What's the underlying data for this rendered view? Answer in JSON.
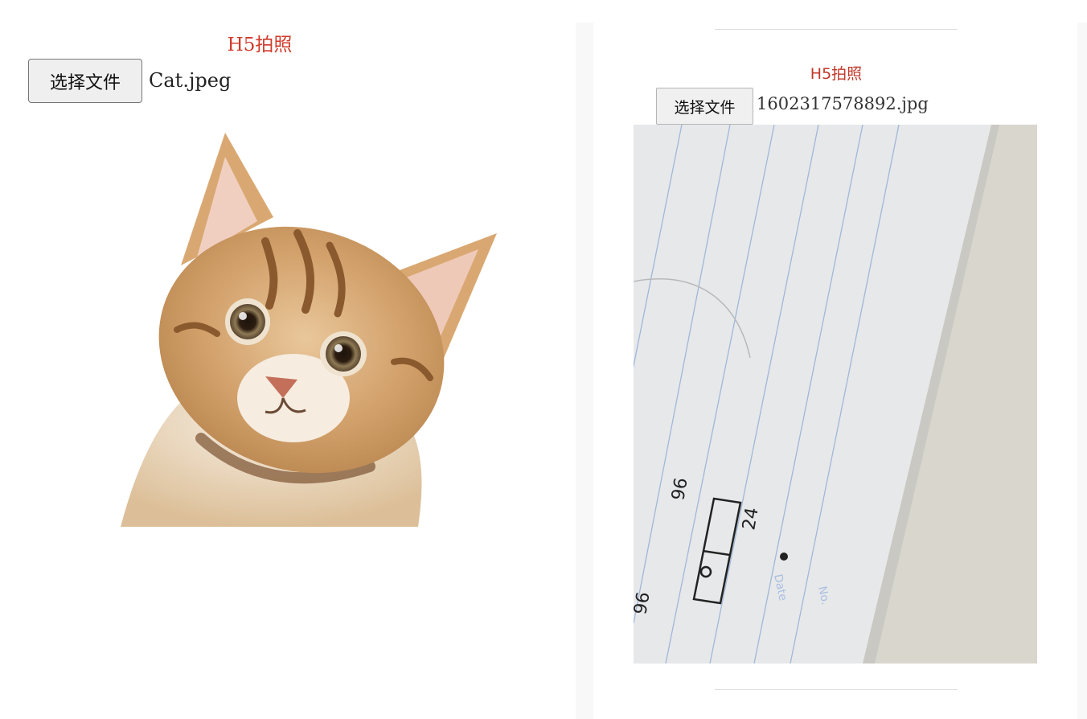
{
  "left": {
    "title": "H5拍照",
    "file_button_label": "选择文件",
    "file_name": "Cat.jpeg"
  },
  "right": {
    "title": "H5拍照",
    "file_button_label": "选择文件",
    "file_name": "1602317578892.jpg",
    "photo_text": {
      "handwriting_a": "96",
      "handwriting_b": "24",
      "handwriting_c": "96",
      "date_label": "Date",
      "no_label": "No."
    }
  }
}
